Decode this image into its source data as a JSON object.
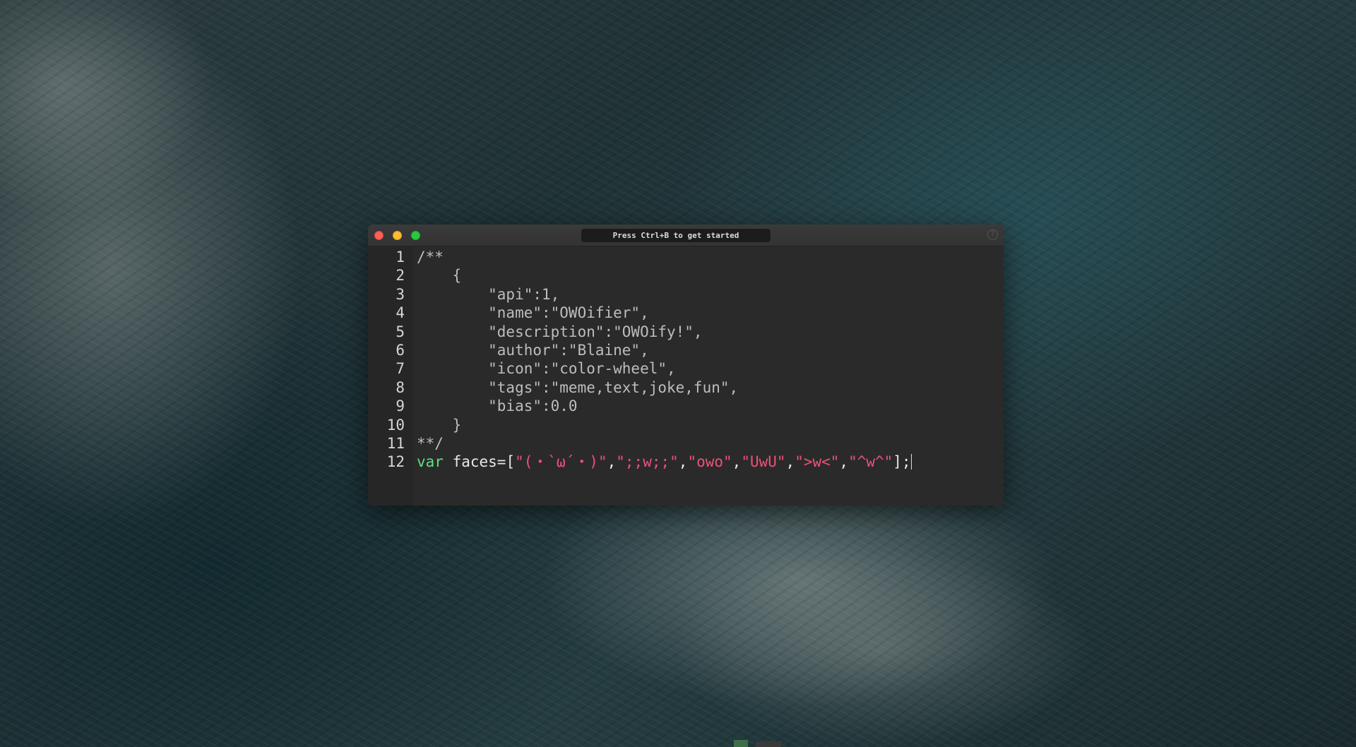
{
  "window": {
    "command_bar_text": "Press Ctrl+B to get started",
    "help_icon": "help-circle-icon"
  },
  "editor": {
    "lines": [
      {
        "number": "1",
        "segments": [
          {
            "text": "/**",
            "style": "comment"
          }
        ]
      },
      {
        "number": "2",
        "segments": [
          {
            "text": "    {",
            "style": "comment"
          }
        ]
      },
      {
        "number": "3",
        "segments": [
          {
            "text": "        \"api\":1,",
            "style": "comment"
          }
        ]
      },
      {
        "number": "4",
        "segments": [
          {
            "text": "        \"name\":\"OWOifier\",",
            "style": "comment"
          }
        ]
      },
      {
        "number": "5",
        "segments": [
          {
            "text": "        \"description\":\"OWOify!\",",
            "style": "comment"
          }
        ]
      },
      {
        "number": "6",
        "segments": [
          {
            "text": "        \"author\":\"Blaine\",",
            "style": "comment"
          }
        ]
      },
      {
        "number": "7",
        "segments": [
          {
            "text": "        \"icon\":\"color-wheel\",",
            "style": "comment"
          }
        ]
      },
      {
        "number": "8",
        "segments": [
          {
            "text": "        \"tags\":\"meme,text,joke,fun\",",
            "style": "comment"
          }
        ]
      },
      {
        "number": "9",
        "segments": [
          {
            "text": "        \"bias\":0.0",
            "style": "comment"
          }
        ]
      },
      {
        "number": "10",
        "segments": [
          {
            "text": "    }",
            "style": "comment"
          }
        ]
      },
      {
        "number": "11",
        "segments": [
          {
            "text": "**/",
            "style": "comment"
          }
        ]
      },
      {
        "number": "12",
        "segments": [
          {
            "text": "var",
            "style": "keyword"
          },
          {
            "text": " faces=[",
            "style": "plain"
          },
          {
            "text": "\"(・`ω´・)\"",
            "style": "string"
          },
          {
            "text": ",",
            "style": "plain"
          },
          {
            "text": "\";;w;;\"",
            "style": "string"
          },
          {
            "text": ",",
            "style": "plain"
          },
          {
            "text": "\"owo\"",
            "style": "string"
          },
          {
            "text": ",",
            "style": "plain"
          },
          {
            "text": "\"UwU\"",
            "style": "string"
          },
          {
            "text": ",",
            "style": "plain"
          },
          {
            "text": "\">w<\"",
            "style": "string"
          },
          {
            "text": ",",
            "style": "plain"
          },
          {
            "text": "\"^w^\"",
            "style": "string"
          },
          {
            "text": "];",
            "style": "plain"
          }
        ]
      }
    ]
  },
  "colors": {
    "keyword": "#5fe07f",
    "string": "#f0507a",
    "plain": "#e8e8e8",
    "comment": "#bdbdbd",
    "close_button": "#fe5f57",
    "minimize_button": "#febc2e",
    "maximize_button": "#28c840"
  }
}
